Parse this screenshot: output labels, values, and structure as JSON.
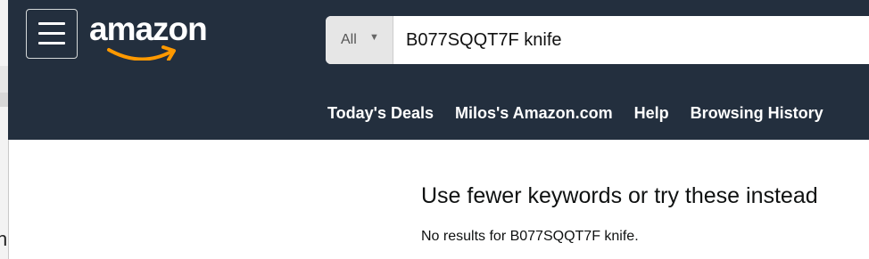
{
  "header": {
    "logo_text": "amazon",
    "menu_icon": "hamburger-menu-icon"
  },
  "search": {
    "category": "All",
    "caret_icon": "caret-down-icon",
    "query": "B077SQQT7F knife"
  },
  "nav": {
    "items": [
      {
        "label": "Today's Deals"
      },
      {
        "label": "Milos's Amazon.com"
      },
      {
        "label": "Help"
      },
      {
        "label": "Browsing History"
      }
    ]
  },
  "results": {
    "headline": "Use fewer keywords or try these instead",
    "no_results_text": "No results for B077SQQT7F knife."
  },
  "colors": {
    "header_bg": "#232f3e",
    "logo_smile": "#ff9900"
  }
}
